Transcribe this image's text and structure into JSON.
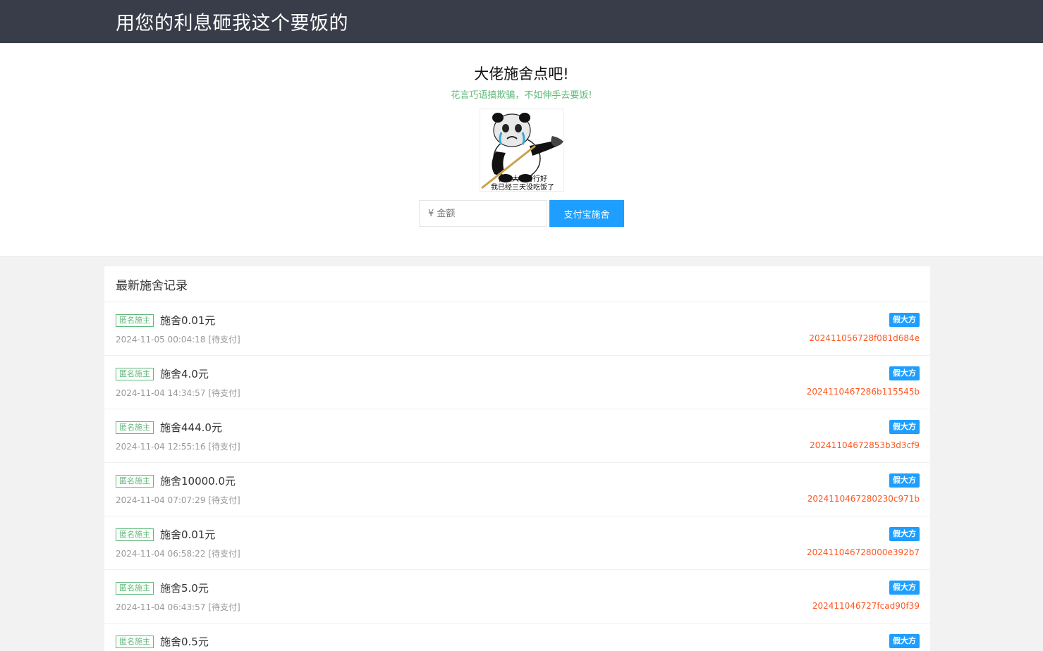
{
  "header": {
    "title": "用您的利息砸我这个要饭的"
  },
  "hero": {
    "title": "大佬施舍点吧!",
    "subtitle": "花言巧语搞欺骗，不如伸手去要饭!",
    "meme_caption_line1": "各位大哥行行好",
    "meme_caption_line2": "我已经三天没吃饭了",
    "amount_placeholder": "¥ 金额",
    "pay_button": "支付宝施舍"
  },
  "records": {
    "title": "最新施舍记录",
    "items": [
      {
        "tag": "匿名施主",
        "amount": "施舍0.01元",
        "time": "2024-11-05 00:04:18 [待支付]",
        "badge": "假大方",
        "order": "202411056728f081d684e"
      },
      {
        "tag": "匿名施主",
        "amount": "施舍4.0元",
        "time": "2024-11-04 14:34:57 [待支付]",
        "badge": "假大方",
        "order": "2024110467286b115545b"
      },
      {
        "tag": "匿名施主",
        "amount": "施舍444.0元",
        "time": "2024-11-04 12:55:16 [待支付]",
        "badge": "假大方",
        "order": "20241104672853b3d3cf9"
      },
      {
        "tag": "匿名施主",
        "amount": "施舍10000.0元",
        "time": "2024-11-04 07:07:29 [待支付]",
        "badge": "假大方",
        "order": "202411046728023 0c971b"
      },
      {
        "tag": "匿名施主",
        "amount": "施舍0.01元",
        "time": "2024-11-04 06:58:22 [待支付]",
        "badge": "假大方",
        "order": "202411046728000e392b7"
      },
      {
        "tag": "匿名施主",
        "amount": "施舍5.0元",
        "time": "2024-11-04 06:43:57 [待支付]",
        "badge": "假大方",
        "order": "202411046727fcad90f39"
      },
      {
        "tag": "匿名施主",
        "amount": "施舍0.5元",
        "time": "",
        "badge": "假大方",
        "order": ""
      }
    ]
  },
  "colors": {
    "topbar": "#393d49",
    "accent": "#1e9fff",
    "tag_green": "#5fb878",
    "order_red": "#ff5722"
  }
}
